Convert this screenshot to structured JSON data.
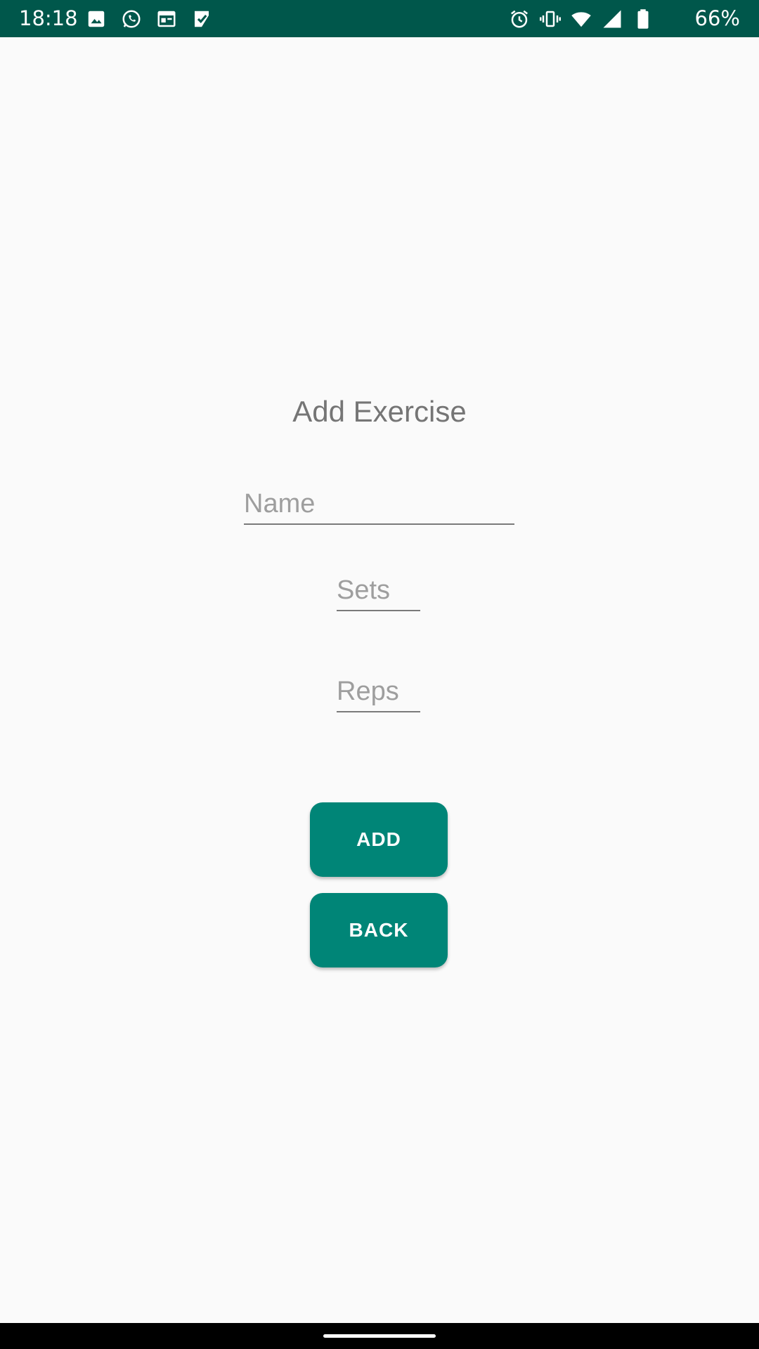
{
  "status_bar": {
    "time": "18:18",
    "battery_percent": "66%",
    "left_icons": [
      "image-icon",
      "whatsapp-icon",
      "calendar-icon",
      "play-store-icon"
    ],
    "right_icons": [
      "alarm-icon",
      "vibrate-icon",
      "wifi-icon",
      "cell-signal-icon",
      "battery-icon"
    ],
    "background_color": "#00574b"
  },
  "form": {
    "title": "Add Exercise",
    "name_placeholder": "Name",
    "sets_placeholder": "Sets",
    "reps_placeholder": "Reps",
    "name_value": "",
    "sets_value": "",
    "reps_value": ""
  },
  "buttons": {
    "add_label": "ADD",
    "back_label": "BACK",
    "color": "#008577"
  }
}
